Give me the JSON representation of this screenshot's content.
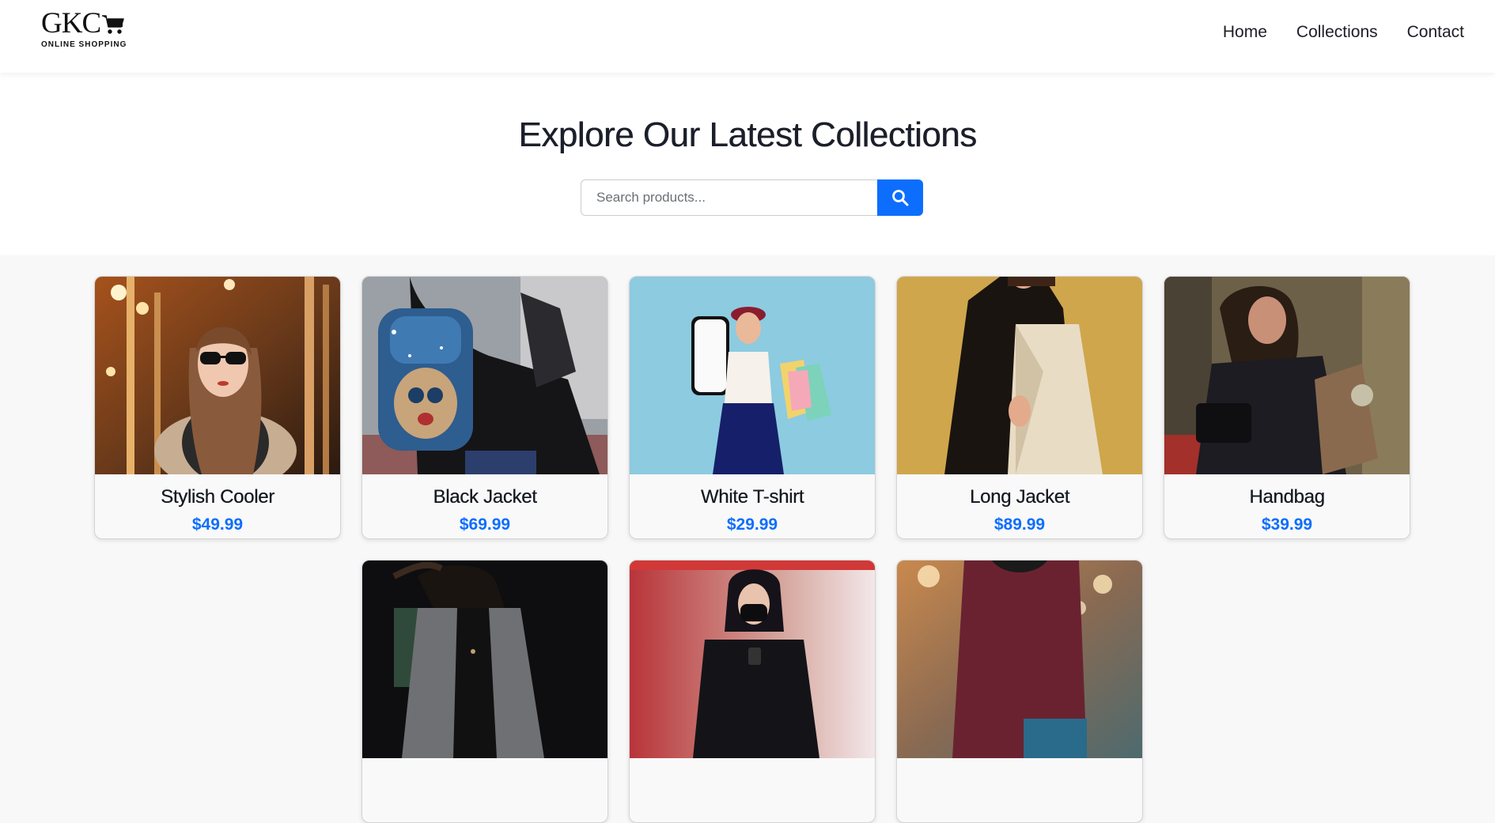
{
  "brand": {
    "name": "GKC",
    "tagline": "ONLINE SHOPPING",
    "icon": "shopping-cart-icon"
  },
  "nav": {
    "links": [
      "Home",
      "Collections",
      "Contact"
    ]
  },
  "hero": {
    "title": "Explore Our Latest Collections",
    "search_placeholder": "Search products...",
    "search_value": "",
    "search_icon": "search-icon"
  },
  "colors": {
    "accent": "#0d6efd",
    "page_background": "#f8f8f8",
    "card_background": "#f9f9f9"
  },
  "products": [
    {
      "name": "Stylish Cooler",
      "price": "$49.99",
      "image": "woman-sunglasses-carousel-photo"
    },
    {
      "name": "Black Jacket",
      "price": "$69.99",
      "image": "blue-sequin-backpack-leather-jacket-photo"
    },
    {
      "name": "White T-shirt",
      "price": "$29.99",
      "image": "woman-phone-shopping-bags-photo"
    },
    {
      "name": "Long Jacket",
      "price": "$89.99",
      "image": "woman-beige-coat-photo"
    },
    {
      "name": "Handbag",
      "price": "$39.99",
      "image": "woman-black-handbag-photo"
    },
    {
      "name": "",
      "price": "",
      "image": "woman-grey-blazer-photo"
    },
    {
      "name": "",
      "price": "",
      "image": "woman-black-mask-phone-photo"
    },
    {
      "name": "",
      "price": "",
      "image": "woman-maroon-sweater-photo"
    }
  ]
}
